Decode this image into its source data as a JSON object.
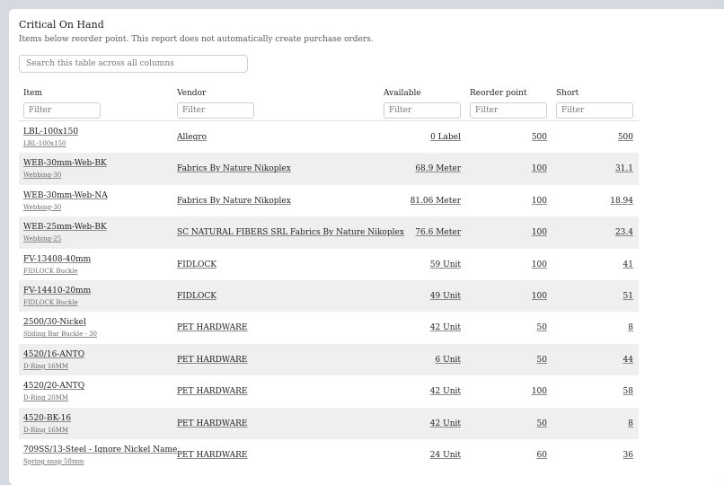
{
  "header": {
    "title": "Critical On Hand",
    "subtitle": "Items below reorder point. This report does not automatically create purchase orders."
  },
  "search": {
    "placeholder": "Search this table across all columns"
  },
  "columns": {
    "item": "Item",
    "vendor": "Vendor",
    "available": "Available",
    "reorder": "Reorder point",
    "short": "Short"
  },
  "filter_placeholder": "Filter",
  "rows": [
    {
      "item": "LBL-100x150",
      "sub": "LBL-100x150",
      "vendor": "Allegro",
      "available": "0 Label",
      "reorder": "500",
      "short": "500"
    },
    {
      "item": "WEB-30mm-Web-BK",
      "sub": "Webbing-30",
      "vendor": "Fabrics By Nature Nikoplex",
      "available": "68.9 Meter",
      "reorder": "100",
      "short": "31.1"
    },
    {
      "item": "WEB-30mm-Web-NA",
      "sub": "Webbing-30",
      "vendor": "Fabrics By Nature Nikoplex",
      "available": "81.06 Meter",
      "reorder": "100",
      "short": "18.94"
    },
    {
      "item": "WEB-25mm-Web-BK",
      "sub": "Webbing-25",
      "vendor": "SC NATURAL FIBERS SRL Fabrics By Nature Nikoplex",
      "available": "76.6 Meter",
      "reorder": "100",
      "short": "23.4"
    },
    {
      "item": "FV-13408-40mm",
      "sub": "FIDLOCK Buckle",
      "vendor": "FIDLOCK",
      "available": "59 Unit",
      "reorder": "100",
      "short": "41"
    },
    {
      "item": "FV-14410-20mm",
      "sub": "FIDLOCK Buckle",
      "vendor": "FIDLOCK",
      "available": "49 Unit",
      "reorder": "100",
      "short": "51"
    },
    {
      "item": "2500/30-Nickel",
      "sub": "Sliding Bar Buckle - 30",
      "vendor": "PET HARDWARE",
      "available": "42 Unit",
      "reorder": "50",
      "short": "8"
    },
    {
      "item": "4520/16-ANTQ",
      "sub": "D-Ring 16MM",
      "vendor": "PET HARDWARE",
      "available": "6 Unit",
      "reorder": "50",
      "short": "44"
    },
    {
      "item": "4520/20-ANTQ",
      "sub": "D-Ring 20MM",
      "vendor": "PET HARDWARE",
      "available": "42 Unit",
      "reorder": "100",
      "short": "58"
    },
    {
      "item": "4520-BK-16",
      "sub": "D-Ring 16MM",
      "vendor": "PET HARDWARE",
      "available": "42 Unit",
      "reorder": "50",
      "short": "8"
    },
    {
      "item": "709SS/13-Steel - Ignore Nickel Name",
      "sub": "Spring snap 58mm",
      "vendor": "PET HARDWARE",
      "available": "24 Unit",
      "reorder": "60",
      "short": "36"
    }
  ]
}
